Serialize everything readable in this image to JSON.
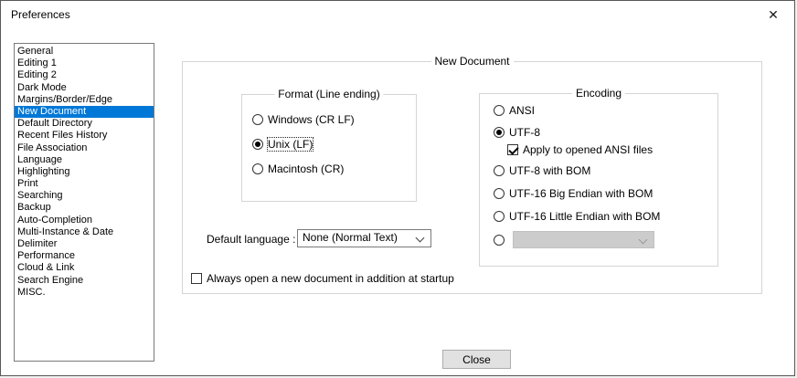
{
  "window": {
    "title": "Preferences",
    "close_glyph": "✕"
  },
  "sidebar": {
    "items": [
      "General",
      "Editing 1",
      "Editing 2",
      "Dark Mode",
      "Margins/Border/Edge",
      "New Document",
      "Default Directory",
      "Recent Files History",
      "File Association",
      "Language",
      "Highlighting",
      "Print",
      "Searching",
      "Backup",
      "Auto-Completion",
      "Multi-Instance & Date",
      "Delimiter",
      "Performance",
      "Cloud & Link",
      "Search Engine",
      "MISC."
    ],
    "selected_index": 5
  },
  "main": {
    "group_title": "New Document",
    "format": {
      "title": "Format (Line ending)",
      "options": [
        {
          "label": "Windows (CR LF)",
          "selected": false,
          "focused": false
        },
        {
          "label": "Unix (LF)",
          "selected": true,
          "focused": true
        },
        {
          "label": "Macintosh (CR)",
          "selected": false,
          "focused": false
        }
      ]
    },
    "encoding": {
      "title": "Encoding",
      "options": [
        {
          "label": "ANSI",
          "selected": false
        },
        {
          "label": "UTF-8",
          "selected": true
        },
        {
          "label": "UTF-8 with BOM",
          "selected": false
        },
        {
          "label": "UTF-16 Big Endian with BOM",
          "selected": false
        },
        {
          "label": "UTF-16 Little Endian with BOM",
          "selected": false
        },
        {
          "label": "",
          "selected": false
        }
      ],
      "apply_checkbox": {
        "label": "Apply to opened ANSI files",
        "checked": true
      },
      "custom_combo": {
        "value": "",
        "disabled": true
      }
    },
    "default_language": {
      "label": "Default language :",
      "value": "None (Normal Text)"
    },
    "startup_checkbox": {
      "label": "Always open a new document in addition at startup",
      "checked": false
    }
  },
  "footer": {
    "close_label": "Close"
  },
  "colors": {
    "selection_bg": "#0078d7",
    "selection_text": "#ffffff",
    "button_face": "#e1e1e1"
  }
}
